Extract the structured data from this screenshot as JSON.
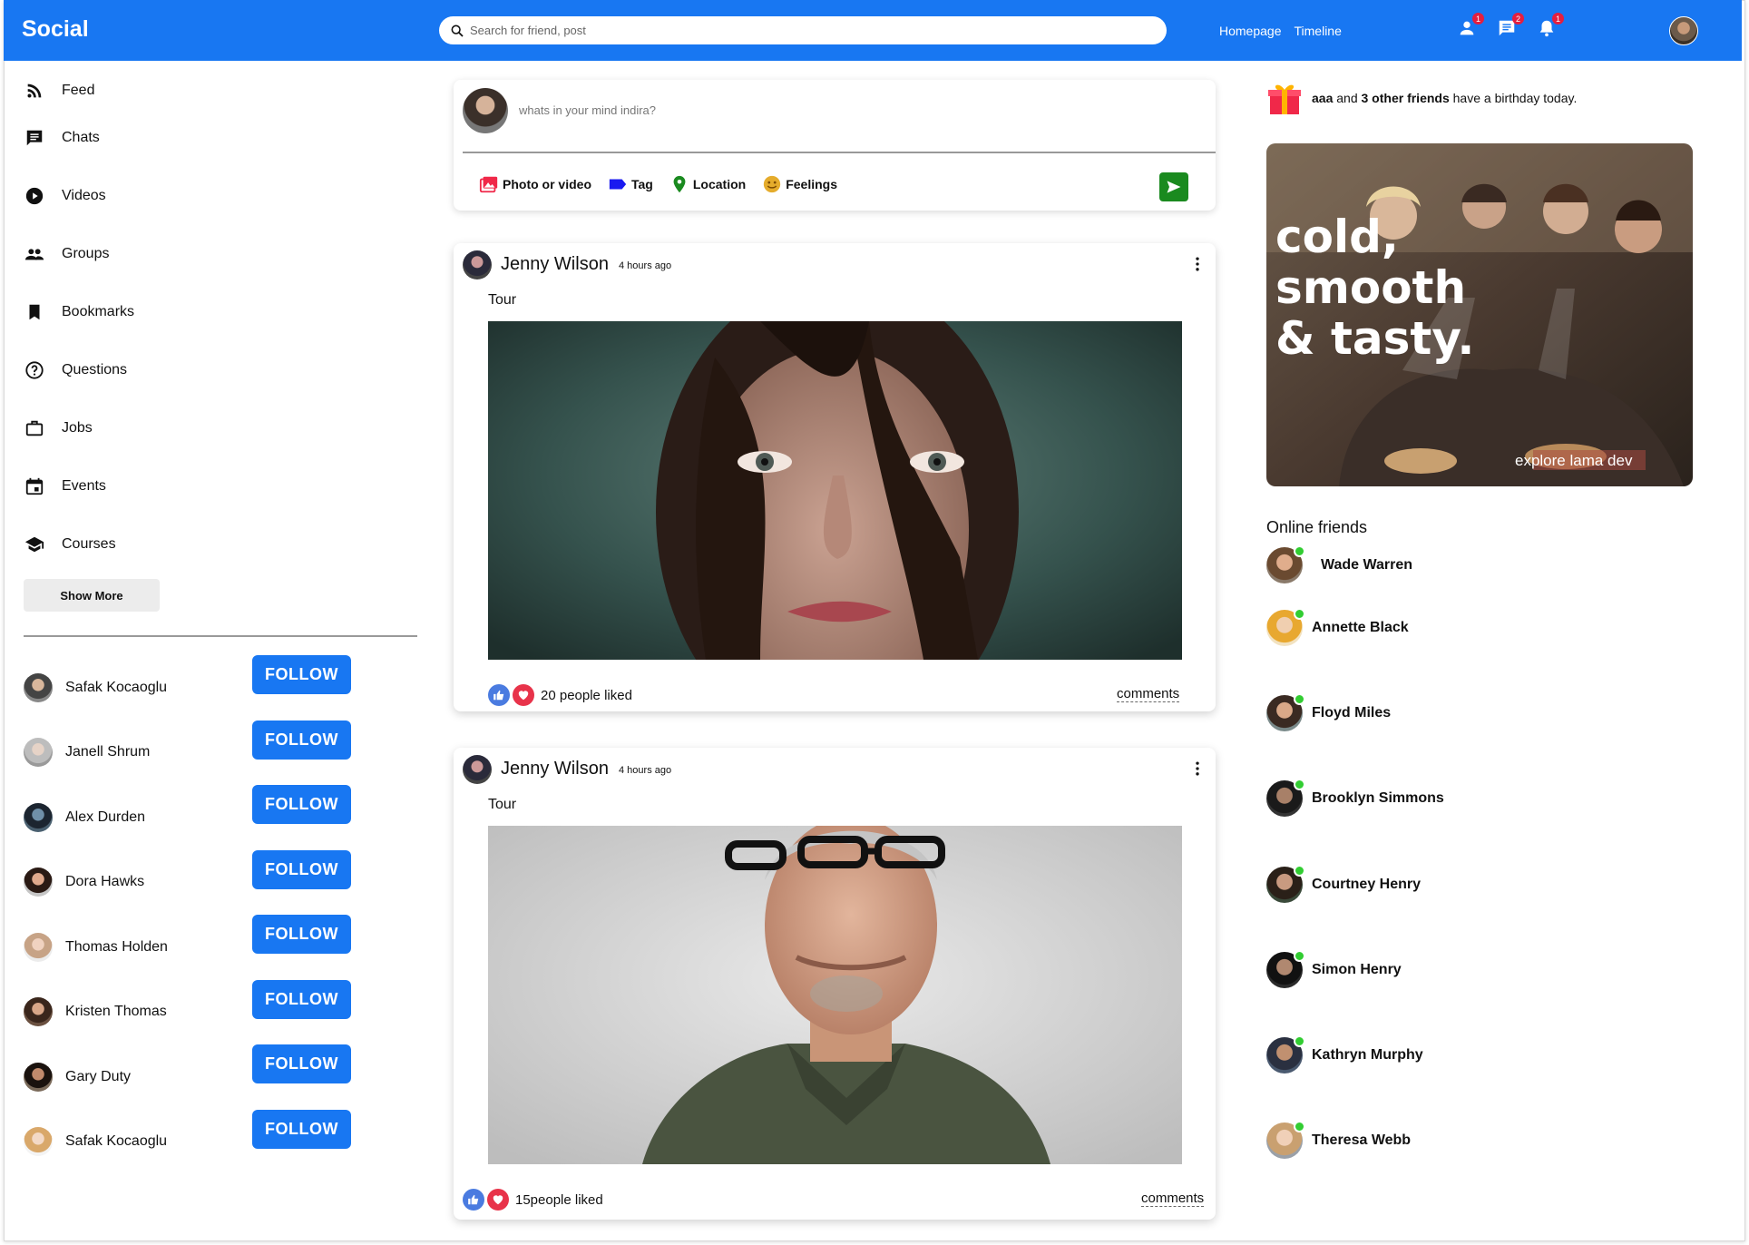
{
  "header": {
    "brand": "Social",
    "search_placeholder": "Search for friend, post",
    "links": [
      "Homepage",
      "Timeline"
    ],
    "badges": {
      "friends": "1",
      "messages": "2",
      "notifications": "1"
    }
  },
  "sidebar": {
    "items": [
      {
        "label": "Feed",
        "icon": "rss-feed-icon"
      },
      {
        "label": "Chats",
        "icon": "chat-icon"
      },
      {
        "label": "Videos",
        "icon": "play-circle-icon"
      },
      {
        "label": "Groups",
        "icon": "group-icon"
      },
      {
        "label": "Bookmarks",
        "icon": "bookmark-icon"
      },
      {
        "label": "Questions",
        "icon": "help-circle-icon"
      },
      {
        "label": "Jobs",
        "icon": "briefcase-icon"
      },
      {
        "label": "Events",
        "icon": "calendar-icon"
      },
      {
        "label": "Courses",
        "icon": "school-icon"
      }
    ],
    "show_more": "Show More",
    "follow_label": "FOLLOW",
    "suggestions": [
      "Safak Kocaoglu",
      "Janell Shrum",
      "Alex Durden",
      "Dora Hawks",
      "Thomas Holden",
      "Kristen Thomas",
      "Gary Duty",
      "Safak Kocaoglu"
    ]
  },
  "share": {
    "placeholder": "whats in your mind indira?",
    "options": [
      "Photo or video",
      "Tag",
      "Location",
      "Feelings"
    ]
  },
  "posts": [
    {
      "author": "Jenny Wilson",
      "time": "4 hours ago",
      "text": "Tour",
      "likes": "20 people liked",
      "comments": "comments"
    },
    {
      "author": "Jenny Wilson",
      "time": "4 hours ago",
      "text": "Tour",
      "likes": "15people liked",
      "comments": "comments"
    }
  ],
  "rightbar": {
    "birthday": {
      "name": "aaa",
      "middle": " and ",
      "others": "3 other friends",
      "suffix": " have a birthday today."
    },
    "ad": {
      "headline1": "cold,",
      "headline2": "smooth",
      "headline3": "& tasty.",
      "tagline": "explore lama dev"
    },
    "online_title": "Online friends",
    "online": [
      "Wade Warren",
      "Annette Black",
      "Floyd Miles",
      "Brooklyn Simmons",
      "Courtney Henry",
      "Simon Henry",
      "Kathryn Murphy",
      "Theresa Webb"
    ]
  },
  "colors": {
    "primary": "#1877f2",
    "online": "#32cd32",
    "badge": "#e41e3f",
    "send": "#1a8a1f"
  }
}
